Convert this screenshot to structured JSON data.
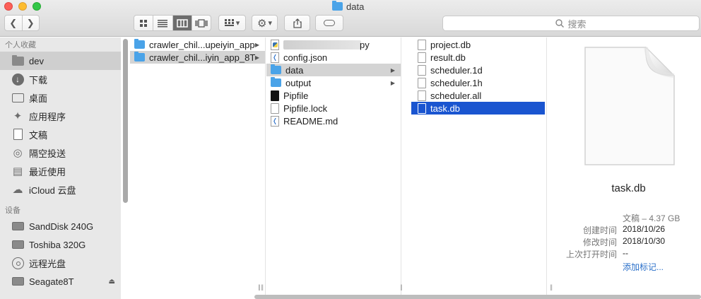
{
  "window": {
    "title": "data"
  },
  "toolbar": {
    "back_icon": "chevron-left",
    "forward_icon": "chevron-right",
    "search_placeholder": "搜索"
  },
  "sidebar": {
    "favorites_header": "个人收藏",
    "favorites": [
      {
        "label": "dev",
        "icon": "folder",
        "selected": true
      },
      {
        "label": "下载",
        "icon": "download"
      },
      {
        "label": "桌面",
        "icon": "desktop"
      },
      {
        "label": "应用程序",
        "icon": "applications"
      },
      {
        "label": "文稿",
        "icon": "documents"
      },
      {
        "label": "隔空投送",
        "icon": "airdrop"
      },
      {
        "label": "最近使用",
        "icon": "recents"
      },
      {
        "label": "iCloud 云盘",
        "icon": "cloud"
      }
    ],
    "devices_header": "设备",
    "devices": [
      {
        "label": "SandDisk 240G",
        "icon": "drive"
      },
      {
        "label": "Toshiba 320G",
        "icon": "drive"
      },
      {
        "label": "远程光盘",
        "icon": "disc"
      },
      {
        "label": "Seagate8T",
        "icon": "drive",
        "eject": true
      }
    ]
  },
  "columns": {
    "col1": [
      {
        "name": "crawler_chil...upeiyin_app",
        "type": "folder"
      },
      {
        "name": "crawler_chil...iyin_app_8T",
        "type": "folder",
        "selected": "grey"
      }
    ],
    "col2": [
      {
        "name": "py",
        "type": "python",
        "blurred": true
      },
      {
        "name": "config.json",
        "type": "vscode"
      },
      {
        "name": "data",
        "type": "folder",
        "selected": "grey",
        "arrow": true
      },
      {
        "name": "output",
        "type": "folder",
        "arrow": true
      },
      {
        "name": "Pipfile",
        "type": "black"
      },
      {
        "name": "Pipfile.lock",
        "type": "doc"
      },
      {
        "name": "README.md",
        "type": "vscode"
      }
    ],
    "col3": [
      {
        "name": "project.db",
        "type": "doc"
      },
      {
        "name": "result.db",
        "type": "doc"
      },
      {
        "name": "scheduler.1d",
        "type": "doc"
      },
      {
        "name": "scheduler.1h",
        "type": "doc"
      },
      {
        "name": "scheduler.all",
        "type": "doc"
      },
      {
        "name": "task.db",
        "type": "doc",
        "selected": "blue"
      }
    ]
  },
  "preview": {
    "filename": "task.db",
    "kind_size": "文稿 – 4.37 GB",
    "created_label": "创建时间",
    "created_value": "2018/10/26",
    "modified_label": "修改时间",
    "modified_value": "2018/10/30",
    "opened_label": "上次打开时间",
    "opened_value": "--",
    "add_tags": "添加标记..."
  },
  "colors": {
    "selection_blue": "#1a55d0",
    "folder_blue": "#4aa3e8",
    "link_blue": "#2a6fc9"
  }
}
